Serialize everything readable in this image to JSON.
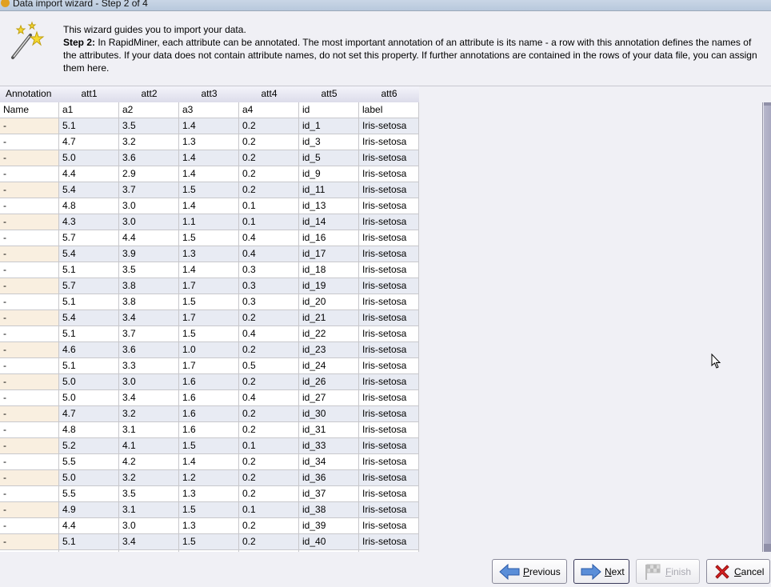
{
  "window": {
    "title": "Data import wizard - Step 2 of 4"
  },
  "description": {
    "intro": "This wizard guides you to import your data.",
    "step_label": "Step 2:",
    "step_text": " In RapidMiner, each attribute can be annotated. The most important annotation of an attribute is its name - a row with this annotation defines the names of the attributes. If your data does not contain attribute names, do not set this property. If further annotations are contained in the rows of your data file, you can assign them here."
  },
  "table": {
    "headers": [
      "Annotation",
      "att1",
      "att2",
      "att3",
      "att4",
      "att5",
      "att6"
    ],
    "name_row": [
      "Name",
      "a1",
      "a2",
      "a3",
      "a4",
      "id",
      "label"
    ],
    "rows": [
      [
        "-",
        "5.1",
        "3.5",
        "1.4",
        "0.2",
        "id_1",
        "Iris-setosa"
      ],
      [
        "-",
        "4.7",
        "3.2",
        "1.3",
        "0.2",
        "id_3",
        "Iris-setosa"
      ],
      [
        "-",
        "5.0",
        "3.6",
        "1.4",
        "0.2",
        "id_5",
        "Iris-setosa"
      ],
      [
        "-",
        "4.4",
        "2.9",
        "1.4",
        "0.2",
        "id_9",
        "Iris-setosa"
      ],
      [
        "-",
        "5.4",
        "3.7",
        "1.5",
        "0.2",
        "id_11",
        "Iris-setosa"
      ],
      [
        "-",
        "4.8",
        "3.0",
        "1.4",
        "0.1",
        "id_13",
        "Iris-setosa"
      ],
      [
        "-",
        "4.3",
        "3.0",
        "1.1",
        "0.1",
        "id_14",
        "Iris-setosa"
      ],
      [
        "-",
        "5.7",
        "4.4",
        "1.5",
        "0.4",
        "id_16",
        "Iris-setosa"
      ],
      [
        "-",
        "5.4",
        "3.9",
        "1.3",
        "0.4",
        "id_17",
        "Iris-setosa"
      ],
      [
        "-",
        "5.1",
        "3.5",
        "1.4",
        "0.3",
        "id_18",
        "Iris-setosa"
      ],
      [
        "-",
        "5.7",
        "3.8",
        "1.7",
        "0.3",
        "id_19",
        "Iris-setosa"
      ],
      [
        "-",
        "5.1",
        "3.8",
        "1.5",
        "0.3",
        "id_20",
        "Iris-setosa"
      ],
      [
        "-",
        "5.4",
        "3.4",
        "1.7",
        "0.2",
        "id_21",
        "Iris-setosa"
      ],
      [
        "-",
        "5.1",
        "3.7",
        "1.5",
        "0.4",
        "id_22",
        "Iris-setosa"
      ],
      [
        "-",
        "4.6",
        "3.6",
        "1.0",
        "0.2",
        "id_23",
        "Iris-setosa"
      ],
      [
        "-",
        "5.1",
        "3.3",
        "1.7",
        "0.5",
        "id_24",
        "Iris-setosa"
      ],
      [
        "-",
        "5.0",
        "3.0",
        "1.6",
        "0.2",
        "id_26",
        "Iris-setosa"
      ],
      [
        "-",
        "5.0",
        "3.4",
        "1.6",
        "0.4",
        "id_27",
        "Iris-setosa"
      ],
      [
        "-",
        "4.7",
        "3.2",
        "1.6",
        "0.2",
        "id_30",
        "Iris-setosa"
      ],
      [
        "-",
        "4.8",
        "3.1",
        "1.6",
        "0.2",
        "id_31",
        "Iris-setosa"
      ],
      [
        "-",
        "5.2",
        "4.1",
        "1.5",
        "0.1",
        "id_33",
        "Iris-setosa"
      ],
      [
        "-",
        "5.5",
        "4.2",
        "1.4",
        "0.2",
        "id_34",
        "Iris-setosa"
      ],
      [
        "-",
        "5.0",
        "3.2",
        "1.2",
        "0.2",
        "id_36",
        "Iris-setosa"
      ],
      [
        "-",
        "5.5",
        "3.5",
        "1.3",
        "0.2",
        "id_37",
        "Iris-setosa"
      ],
      [
        "-",
        "4.9",
        "3.1",
        "1.5",
        "0.1",
        "id_38",
        "Iris-setosa"
      ],
      [
        "-",
        "4.4",
        "3.0",
        "1.3",
        "0.2",
        "id_39",
        "Iris-setosa"
      ],
      [
        "-",
        "5.1",
        "3.4",
        "1.5",
        "0.2",
        "id_40",
        "Iris-setosa"
      ],
      [
        "",
        "",
        "",
        "",
        "",
        "",
        ""
      ]
    ]
  },
  "buttons": {
    "previous": {
      "mnemonic": "P",
      "rest": "revious"
    },
    "next": {
      "mnemonic": "N",
      "rest": "ext"
    },
    "finish": {
      "mnemonic": "F",
      "rest": "inish",
      "enabled": false
    },
    "cancel": {
      "mnemonic": "C",
      "rest": "ancel"
    }
  },
  "colors": {
    "annotation_cell": "#f9efe0",
    "alt_row": "#e8ebf3"
  }
}
